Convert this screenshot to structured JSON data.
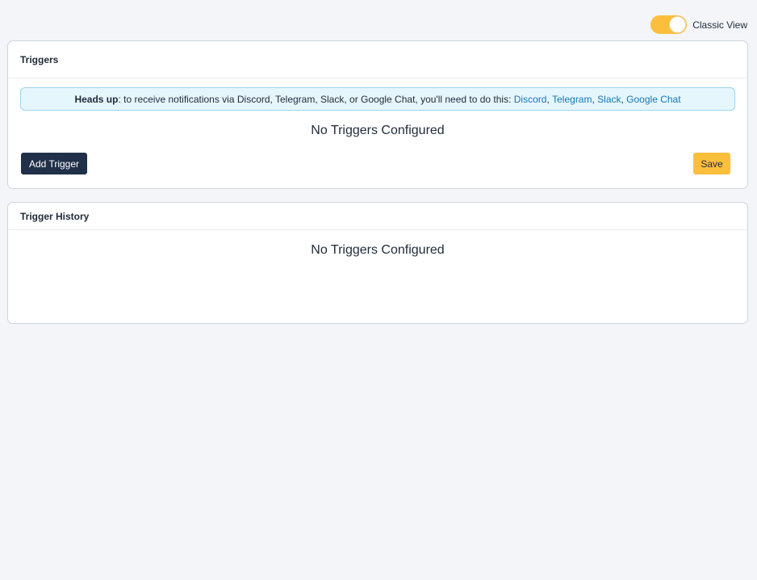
{
  "view_toggle": {
    "label": "Classic View",
    "on": true
  },
  "triggers": {
    "title": "Triggers",
    "alert": {
      "strong": "Heads up",
      "text": ": to receive notifications via Discord, Telegram, Slack, or Google Chat, you'll need to do this: ",
      "links": [
        "Discord",
        "Telegram",
        "Slack",
        "Google Chat"
      ],
      "separator": ", "
    },
    "empty_text": "No Triggers Configured",
    "add_label": "Add Trigger",
    "save_label": "Save"
  },
  "history": {
    "title": "Trigger History",
    "empty_text": "No Triggers Configured"
  },
  "colors": {
    "accent": "#fbbf3c",
    "dark_button": "#203049",
    "link": "#1477b3",
    "alert_bg": "#e6f6fd"
  }
}
